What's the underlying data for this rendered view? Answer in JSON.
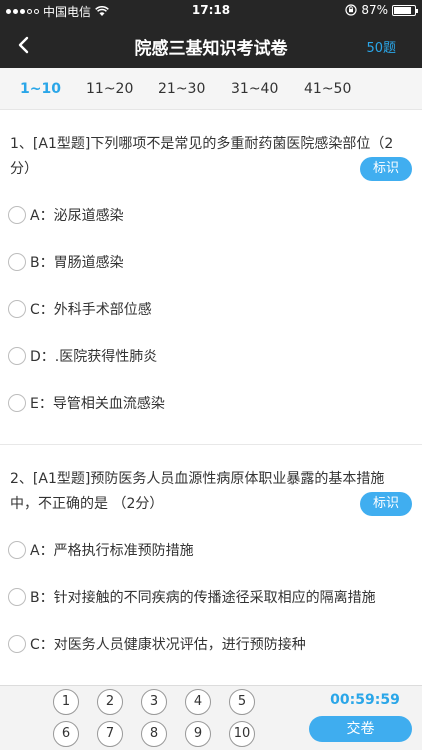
{
  "status_bar": {
    "carrier": "中国电信",
    "time": "17:18",
    "battery": "87%",
    "battery_level": 0.87
  },
  "header": {
    "title": "院感三基知识考试卷",
    "question_count": "50题"
  },
  "tabs": [
    {
      "label": "1~10",
      "active": true
    },
    {
      "label": "11~20",
      "active": false
    },
    {
      "label": "21~30",
      "active": false
    },
    {
      "label": "31~40",
      "active": false
    },
    {
      "label": "41~50",
      "active": false
    }
  ],
  "questions": [
    {
      "title_line1": "1、[A1型题]下列哪项不是常见的多重耐药菌医院感染部位（2",
      "title_line2": "分）",
      "mark_label": "标识",
      "options": [
        "A：泌尿道感染",
        "B：胃肠道感染",
        "C：外科手术部位感",
        "D：.医院获得性肺炎",
        "E：导管相关血流感染"
      ]
    },
    {
      "title_line1": "2、[A1型题]预防医务人员血源性病原体职业暴露的基本措施",
      "title_line2": "中，不正确的是 （2分）",
      "mark_label": "标识",
      "options": [
        "A：严格执行标准预防措施",
        "B：针对接触的不同疾病的传播途径采取相应的隔离措施",
        "C：对医务人员健康状况评估，进行预防接种"
      ]
    }
  ],
  "bottom_bar": {
    "numbers": [
      "1",
      "2",
      "3",
      "4",
      "5",
      "6",
      "7",
      "8",
      "9",
      "10"
    ],
    "timer": "00:59:59",
    "submit_label": "交卷"
  }
}
